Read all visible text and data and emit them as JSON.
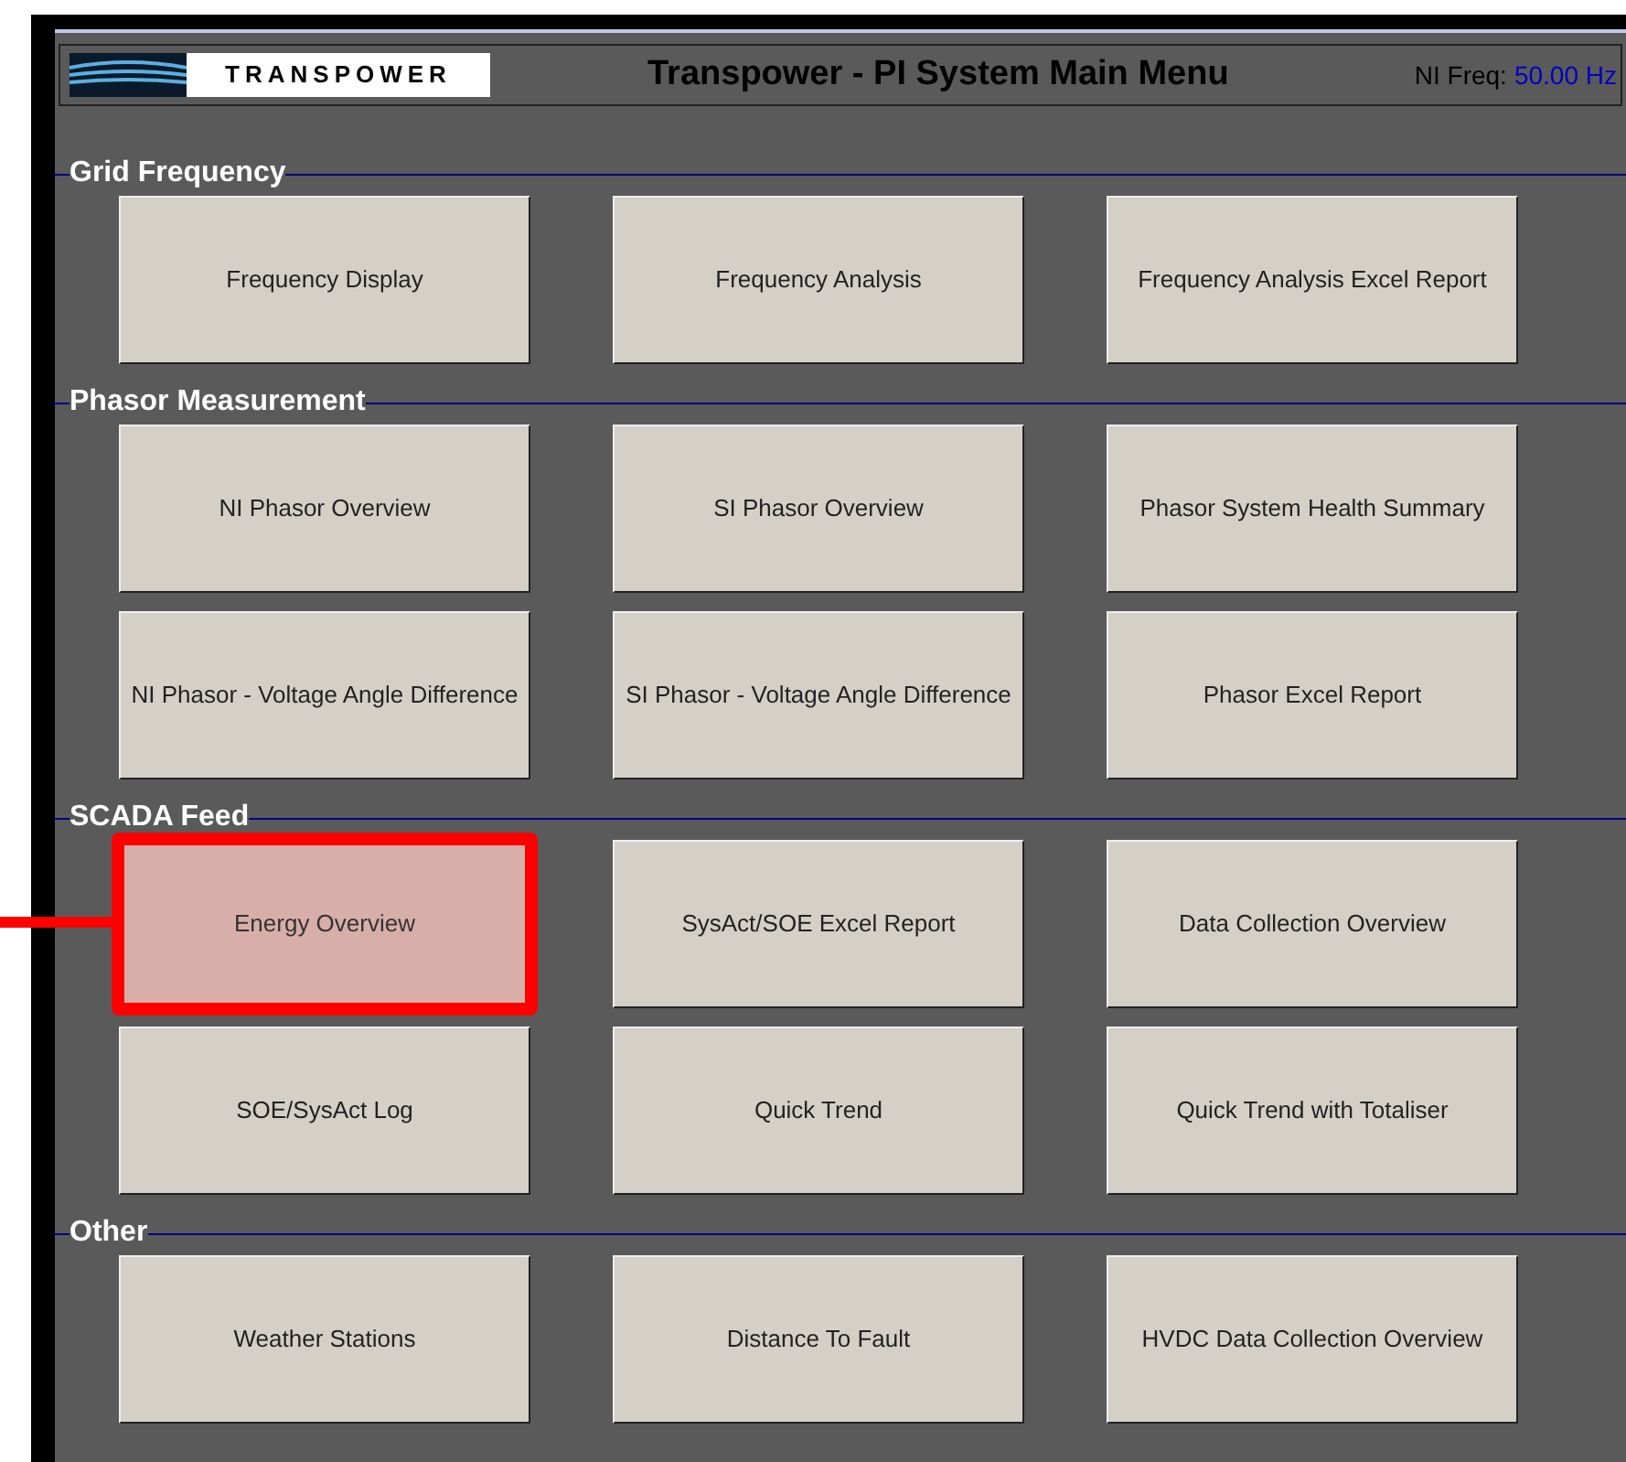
{
  "header": {
    "logo": "TRANSPOWER",
    "title": "Transpower - PI System Main Menu",
    "freq_label": "NI Freq:",
    "freq_value": "50.00 Hz"
  },
  "sections": [
    {
      "title": "Grid Frequency",
      "rows": [
        [
          {
            "label": "Frequency Display",
            "highlighted": false
          },
          {
            "label": "Frequency Analysis",
            "highlighted": false
          },
          {
            "label": "Frequency Analysis Excel Report",
            "highlighted": false
          }
        ]
      ]
    },
    {
      "title": "Phasor Measurement",
      "rows": [
        [
          {
            "label": "NI Phasor Overview",
            "highlighted": false
          },
          {
            "label": "SI Phasor Overview",
            "highlighted": false
          },
          {
            "label": "Phasor System Health Summary",
            "highlighted": false
          }
        ],
        [
          {
            "label": "NI Phasor - Voltage Angle Difference",
            "highlighted": false
          },
          {
            "label": "SI Phasor - Voltage Angle Difference",
            "highlighted": false
          },
          {
            "label": "Phasor Excel Report",
            "highlighted": false
          }
        ]
      ]
    },
    {
      "title": "SCADA Feed",
      "rows": [
        [
          {
            "label": "Energy Overview",
            "highlighted": true
          },
          {
            "label": "SysAct/SOE Excel Report",
            "highlighted": false
          },
          {
            "label": "Data Collection Overview",
            "highlighted": false
          }
        ],
        [
          {
            "label": "SOE/SysAct Log",
            "highlighted": false
          },
          {
            "label": "Quick Trend",
            "highlighted": false
          },
          {
            "label": "Quick Trend with Totaliser",
            "highlighted": false
          }
        ]
      ]
    },
    {
      "title": "Other",
      "rows": [
        [
          {
            "label": "Weather Stations",
            "highlighted": false
          },
          {
            "label": "Distance To Fault",
            "highlighted": false
          },
          {
            "label": "HVDC Data Collection Overview",
            "highlighted": false
          }
        ]
      ]
    }
  ]
}
